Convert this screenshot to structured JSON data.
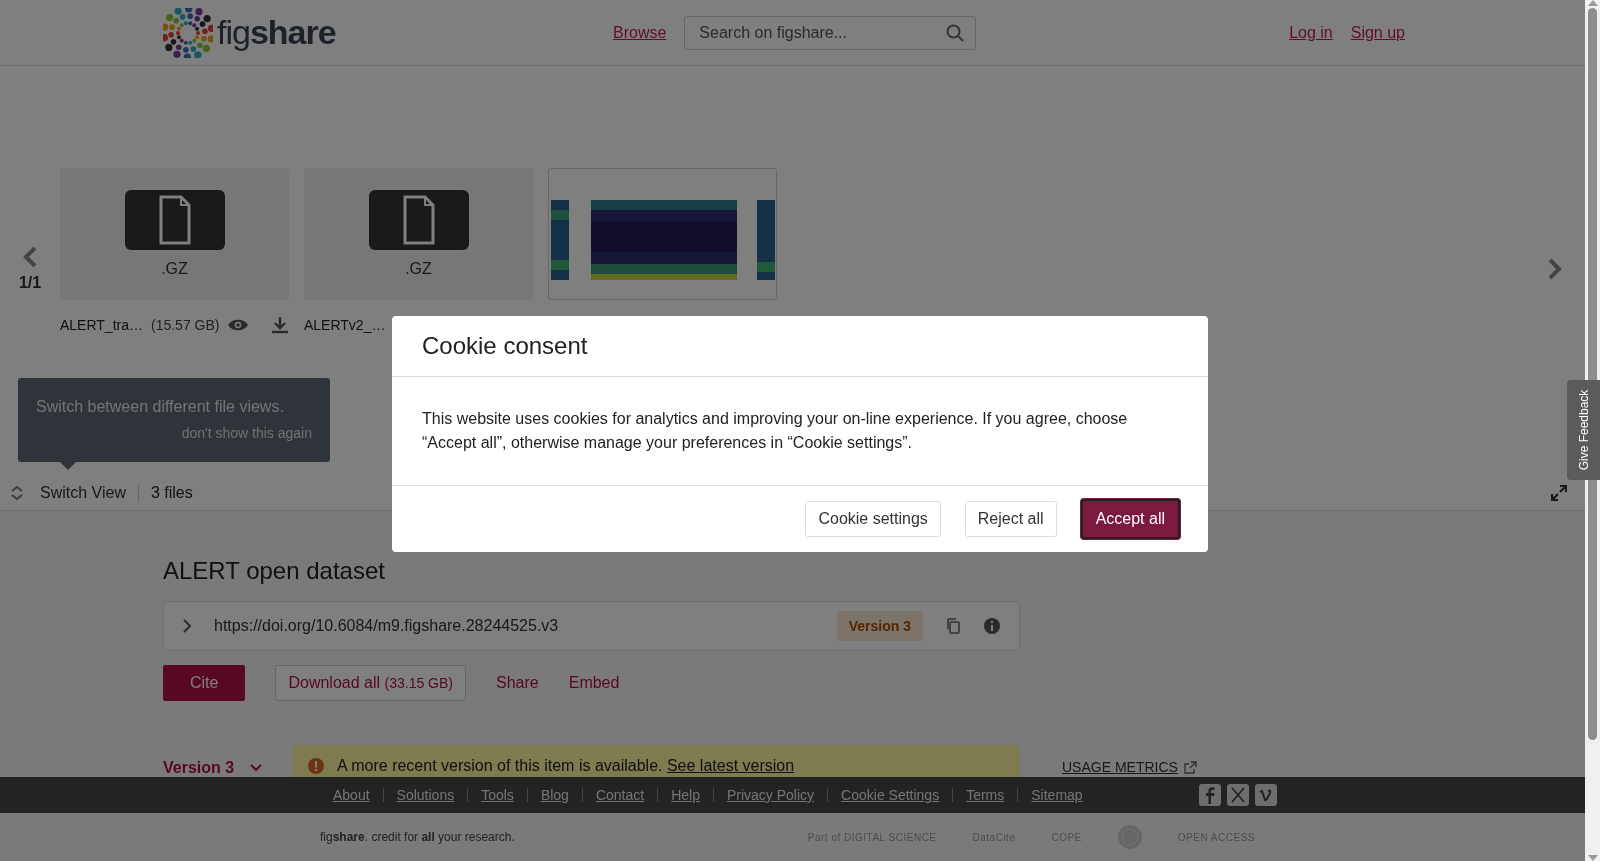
{
  "header": {
    "logo": "fig**share**",
    "nav_link": "Browse",
    "search": {
      "placeholder": "Search on figshare..."
    },
    "account_links": [
      "Log in",
      "Sign up"
    ]
  },
  "viewer": {
    "page": "1/1",
    "files": [
      {
        "kind": "file",
        "ext": ".GZ",
        "name": "ALERT_tra…",
        "size": "(15.57 GB)"
      },
      {
        "kind": "file",
        "ext": ".GZ",
        "name": "ALERTv2_…"
      },
      {
        "kind": "picture"
      }
    ],
    "tooltip": {
      "text": "Switch between different file views.",
      "dismiss": "don't show this again"
    },
    "switch_view": "Switch View",
    "file_count": "3 files"
  },
  "item": {
    "title": "ALERT open dataset",
    "doi": "https://doi.org/10.6084/m9.figshare.28244525.v3",
    "version_badge": "Version 3",
    "actions": [
      {
        "kind": "primary",
        "label": "Cite"
      },
      {
        "kind": "outline",
        "label": "Download all",
        "note": "(33.15 GB)"
      },
      {
        "kind": "link",
        "label": "Share"
      },
      {
        "kind": "link",
        "label": "Embed"
      }
    ],
    "version_select": "Version 3",
    "notice": {
      "text": "A more recent version of this item is available.",
      "link": "See latest version"
    },
    "usage_metrics": "USAGE METRICS"
  },
  "feedback_tab": "Give Feedback",
  "footer": {
    "links": [
      "About",
      "Solutions",
      "Tools",
      "Blog",
      "Contact",
      "Help",
      "Privacy Policy",
      "Cookie Settings",
      "Terms",
      "Sitemap"
    ],
    "tagline": "fig**share**. credit for **all** your research.",
    "partners": [
      {
        "kind": "wordmark",
        "label": "Part of DIGITAL SCIENCE"
      },
      {
        "kind": "wordmark",
        "label": "DataCite"
      },
      {
        "kind": "wordmark",
        "label": "COPE"
      },
      {
        "kind": "seal"
      },
      {
        "kind": "wordmark",
        "label": "OPEN ACCESS"
      }
    ]
  },
  "cookie_dialog": {
    "title": "Cookie consent",
    "body": "This website uses cookies for analytics and improving your on-line experience. If you agree, choose “Accept all”, otherwise manage your preferences in “Cookie settings”.",
    "buttons": [
      {
        "kind": "secondary",
        "label": "Cookie settings"
      },
      {
        "kind": "secondary",
        "label": "Reject all"
      },
      {
        "kind": "primary",
        "label": "Accept all"
      }
    ]
  }
}
